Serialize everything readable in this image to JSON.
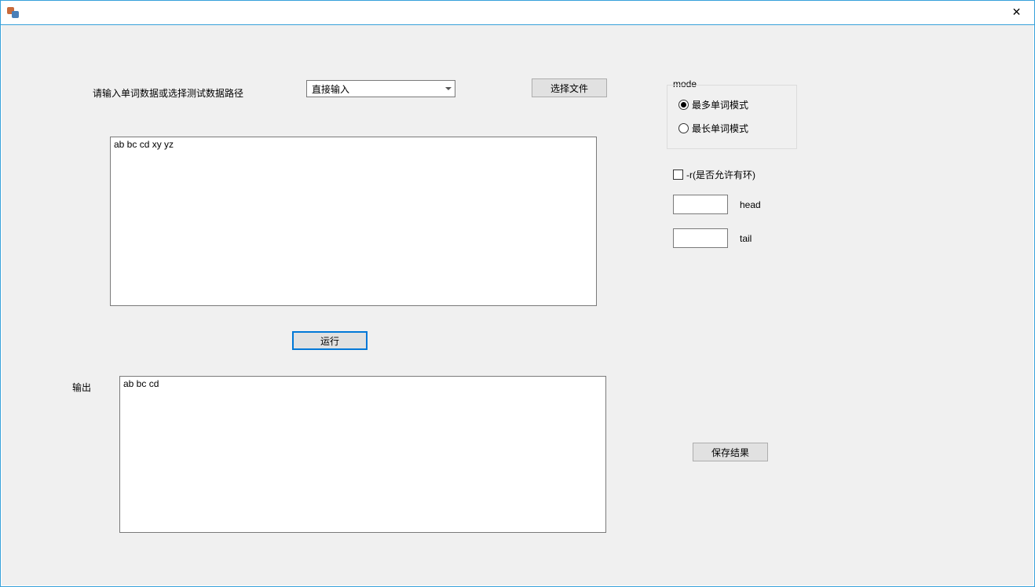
{
  "window": {
    "title": ""
  },
  "top": {
    "prompt_label": "请输入单词数据或选择测试数据路径",
    "combo_selected": "直接输入",
    "choose_file_button": "选择文件"
  },
  "input_area": {
    "value": "ab bc cd xy yz"
  },
  "run_button": "运行",
  "output": {
    "label": "输出",
    "value": "ab bc cd"
  },
  "mode_group": {
    "legend": "mode",
    "option_most_words": "最多单词模式",
    "option_longest_words": "最长单词模式",
    "selected": "most"
  },
  "allow_cycle": {
    "label": "-r(是否允许有环)",
    "checked": false
  },
  "head": {
    "label": "head",
    "value": ""
  },
  "tail": {
    "label": "tail",
    "value": ""
  },
  "save_button": "保存结果"
}
